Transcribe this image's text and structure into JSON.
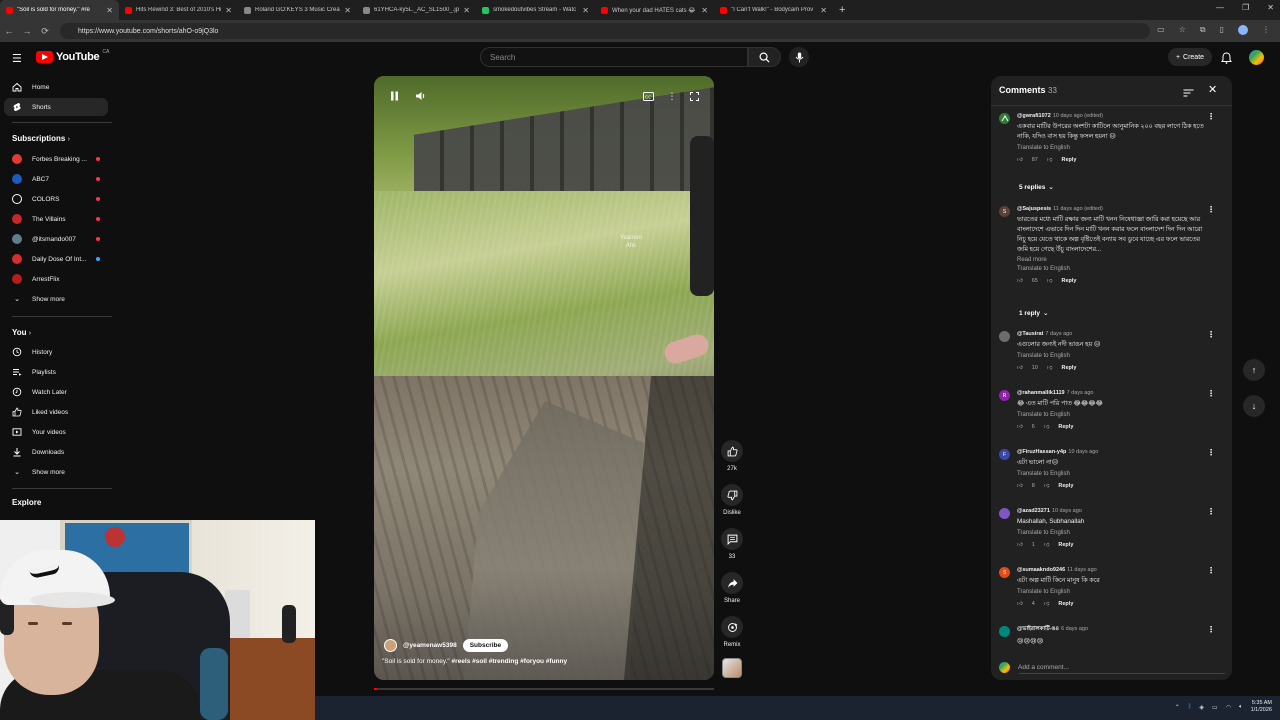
{
  "browser": {
    "tabs": [
      {
        "label": "\"Soil is sold for money.\" #re",
        "active": true,
        "favicon": "youtube"
      },
      {
        "label": "Hits Rewind 3: Best of 2010's Hi",
        "active": false,
        "favicon": "youtube"
      },
      {
        "label": "Roland GO:KEYS 3 Music Creati",
        "active": false,
        "favicon": "doc"
      },
      {
        "label": "61YHCA-ky5L._AC_SL1500_.jpg",
        "active": false,
        "favicon": "doc"
      },
      {
        "label": "smokedoutvibes Stream - Watc",
        "active": false,
        "favicon": "kick"
      },
      {
        "label": "When your dad HATES cats 😂 F",
        "active": false,
        "favicon": "youtube"
      },
      {
        "label": "\"I Can't Walk!\" - Bodycam Prov",
        "active": false,
        "favicon": "youtube"
      }
    ],
    "url": "https://www.youtube.com/shorts/ahO-o9jQ3lo"
  },
  "header": {
    "logo_text": "YouTube",
    "logo_country": "CA",
    "search_placeholder": "Search",
    "create_label": "Create"
  },
  "sidebar": {
    "main": [
      {
        "label": "Home",
        "icon": "home-icon"
      },
      {
        "label": "Shorts",
        "icon": "shorts-icon",
        "active": true
      }
    ],
    "subscriptions_heading": "Subscriptions",
    "subscriptions": [
      {
        "label": "Forbes Breaking ...",
        "color": "#e53935",
        "live": "red"
      },
      {
        "label": "ABC7",
        "color": "#1e5bb8",
        "live": "red"
      },
      {
        "label": "COLORS",
        "color": "#111111",
        "live": "red"
      },
      {
        "label": "The Villains",
        "color": "#c62828",
        "live": "red"
      },
      {
        "label": "@itsmando007",
        "color": "#607d8b",
        "live": "red"
      },
      {
        "label": "Daily Dose Of Int...",
        "color": "#d32f2f",
        "live": "blue"
      },
      {
        "label": "ArrestFlix",
        "color": "#b71c1c",
        "live": ""
      }
    ],
    "subs_show_more": "Show more",
    "you_heading": "You",
    "you_items": [
      {
        "label": "History",
        "icon": "history-icon"
      },
      {
        "label": "Playlists",
        "icon": "playlists-icon"
      },
      {
        "label": "Watch Later",
        "icon": "watch-later-icon"
      },
      {
        "label": "Liked videos",
        "icon": "liked-icon"
      },
      {
        "label": "Your videos",
        "icon": "your-videos-icon"
      },
      {
        "label": "Downloads",
        "icon": "download-icon"
      }
    ],
    "you_show_more": "Show more",
    "explore_heading": "Explore"
  },
  "short": {
    "channel": "@yeamenaw5398",
    "subscribe_label": "Subscribe",
    "caption_text": "\"Soil is sold for money.\" ",
    "caption_tags": "#reels #soil #trending #foryou #funny",
    "watermark": "Yeamen\nAhs",
    "progress": 0.01
  },
  "actions": {
    "like_count": "27k",
    "dislike_label": "Dislike",
    "comments_count": "33",
    "share_label": "Share",
    "remix_label": "Remix"
  },
  "comments": {
    "title": "Comments",
    "count": "33",
    "translate_label": "Translate to English",
    "reply_label": "Reply",
    "read_more": "Read more",
    "add_placeholder": "Add a comment...",
    "items": [
      {
        "author": "@gwrafi1072",
        "time": "10 days ago (edited)",
        "text": "একবার মাটির উপরের অংশটা কাটিলে আনুমানিক ২০০ বছর লাগে ঠিক হতে নাকি, যদিও বাস হয় কিন্তু ফসল হয়না 😑",
        "likes": "87",
        "replies": "5 replies",
        "avatar_color": "#2e7d32",
        "avatar_letter": ""
      },
      {
        "author": "@Sajuspesis",
        "time": "11 days ago (edited)",
        "text": "ভারতের মধ্যে মাটি রক্ষার জন্য মাটি খনন নিষেধাজ্ঞা জারি করা হয়েছে আর বাংলাদেশে এভাবে দিন দিন মাটি খনন করার ফলে বাংলাদেশ দিন দিন আরো নিচু হয়ে যেতে থাকে অল্প বৃষ্টিতেই বন্যায় সব ডুবে যাচ্ছে এর ফলে ভারতের জমি হয়ে গেছে উঁচু বাংলাদেশের...",
        "likes": "65",
        "replies": "1 reply",
        "avatar_color": "#5d4037",
        "avatar_letter": "S",
        "read_more": true
      },
      {
        "author": "@Tausirat",
        "time": "7 days ago",
        "text": "এগুলোর জন্যই নদী ভাঙন হয় 😑",
        "likes": "10",
        "replies": "",
        "avatar_color": "#6d6d6d",
        "avatar_letter": ""
      },
      {
        "author": "@rahanmallik1119",
        "time": "7 days ago",
        "text": "😂 এত মাটি পরি পাত 😂😂😂😂",
        "likes": "6",
        "replies": "",
        "avatar_color": "#8e24aa",
        "avatar_letter": "R"
      },
      {
        "author": "@FiruzHassan-y4p",
        "time": "10 days ago",
        "text": "এটা ভালো না😑",
        "likes": "8",
        "replies": "",
        "avatar_color": "#3949ab",
        "avatar_letter": "F"
      },
      {
        "author": "@azad23271",
        "time": "10 days ago",
        "text": "Mashallah, Subhanallah",
        "likes": "1",
        "replies": "",
        "avatar_color": "#7e57c2",
        "avatar_letter": ""
      },
      {
        "author": "@sumaakndo9246",
        "time": "11 days ago",
        "text": "এটা অল্প মাটি কিনে মানুষ কি করে",
        "likes": "4",
        "replies": "",
        "avatar_color": "#e64a19",
        "avatar_letter": "S"
      },
      {
        "author": "@ভাইরালকার্টি-ঙ৪",
        "time": "6 days ago",
        "text": "😢😢😢😢",
        "likes": "",
        "replies": "",
        "avatar_color": "#00897b",
        "avatar_letter": ""
      }
    ]
  },
  "taskbar": {
    "time": "5:35 AM",
    "date": "1/1/2026"
  },
  "colors": {
    "brand_red": "#ff0000",
    "background": "#0f0f0f",
    "panel": "#212121"
  }
}
